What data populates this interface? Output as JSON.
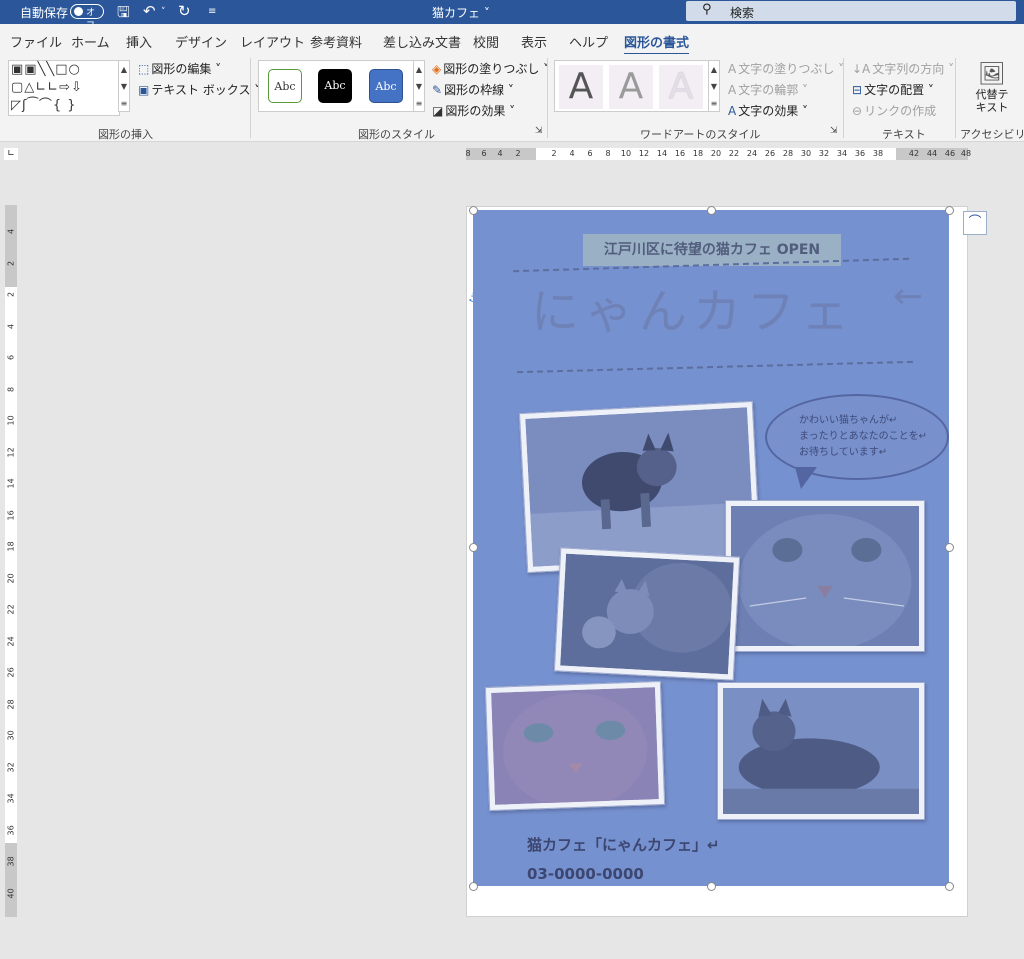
{
  "titlebar": {
    "autosave_label": "自動保存",
    "autosave_state": "オフ",
    "document_title": "猫カフェ ˅",
    "search_placeholder": "検索"
  },
  "tabs": [
    {
      "label": "ファイル"
    },
    {
      "label": "ホーム"
    },
    {
      "label": "挿入"
    },
    {
      "label": "デザイン"
    },
    {
      "label": "レイアウト"
    },
    {
      "label": "参考資料"
    },
    {
      "label": "差し込み文書"
    },
    {
      "label": "校閲"
    },
    {
      "label": "表示"
    },
    {
      "label": "ヘルプ"
    },
    {
      "label": "図形の書式",
      "active": true
    }
  ],
  "ribbon": {
    "insert_shapes": {
      "group_label": "図形の挿入",
      "edit_shape": "図形の編集",
      "text_box": "テキスト ボックス"
    },
    "shape_styles": {
      "group_label": "図形のスタイル",
      "presets": [
        "Abc",
        "Abc",
        "Abc"
      ],
      "fill": "図形の塗りつぶし",
      "outline": "図形の枠線",
      "effects": "図形の効果"
    },
    "wordart": {
      "group_label": "ワードアートのスタイル",
      "presets": [
        "A",
        "A",
        "A"
      ],
      "text_fill": "文字の塗りつぶし",
      "text_outline": "文字の輪郭",
      "text_effects": "文字の効果"
    },
    "text": {
      "group_label": "テキスト",
      "direction": "文字列の方向",
      "align": "文字の配置",
      "link": "リンクの作成"
    },
    "accessibility": {
      "group_label": "アクセシビリティ",
      "alt_text_line1": "代替テ",
      "alt_text_line2": "キスト"
    }
  },
  "ruler": {
    "horizontal_ticks": [
      "8",
      "6",
      "4",
      "2",
      "2",
      "4",
      "6",
      "8",
      "10",
      "12",
      "14",
      "16",
      "18",
      "20",
      "22",
      "24",
      "26",
      "28",
      "30",
      "32",
      "34",
      "36",
      "38",
      "42",
      "44",
      "46",
      "48"
    ],
    "vertical_ticks": [
      "4",
      "2",
      "2",
      "4",
      "6",
      "8",
      "10",
      "12",
      "14",
      "16",
      "18",
      "20",
      "22",
      "24",
      "26",
      "28",
      "30",
      "32",
      "34",
      "36",
      "38",
      "40"
    ]
  },
  "flyer": {
    "subtitle": "江戸川区に待望の猫カフェ OPEN",
    "title": "にゃんカフェ",
    "bubble_lines": [
      "かわいい猫ちゃんが↵",
      "まったりとあなたのことを↵",
      "お待ちしています↵"
    ],
    "shop_name": "猫カフェ「にゃんカフェ」↵",
    "phone": "03-0000-0000"
  },
  "colors": {
    "brand": "#2b579a",
    "selection_overlay": "#7691cf"
  },
  "icons": {
    "save": "save-icon",
    "undo": "undo-icon",
    "redo": "redo-icon",
    "search": "search-icon",
    "anchor": "anchor-icon",
    "layout_options": "layout-options-icon"
  }
}
